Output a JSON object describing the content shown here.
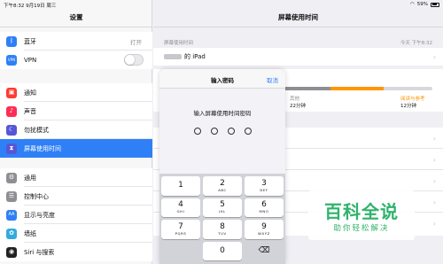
{
  "status_bar": {
    "time_date": "下午8:32  9月19日 周三",
    "battery": "59%"
  },
  "sidebar": {
    "title": "设置",
    "group1": [
      {
        "label": "蓝牙",
        "value": "打开",
        "icon": "bluetooth-icon",
        "icon_glyph": "ᛒ",
        "color": "#2f80f7"
      },
      {
        "label": "VPN",
        "icon": "vpn-icon",
        "icon_glyph": "VPN",
        "color": "#2f80f7"
      }
    ],
    "group2": [
      {
        "label": "通知",
        "icon": "notifications-icon",
        "icon_glyph": "▣",
        "color": "#ff3b30"
      },
      {
        "label": "声音",
        "icon": "sound-icon",
        "icon_glyph": "♪",
        "color": "#ff2d55"
      },
      {
        "label": "勿扰模式",
        "icon": "moon-icon",
        "icon_glyph": "☾",
        "color": "#5856d6"
      },
      {
        "label": "屏幕使用时间",
        "icon": "hourglass-icon",
        "icon_glyph": "⧗",
        "color": "#5856d6"
      }
    ],
    "group3": [
      {
        "label": "通用",
        "icon": "gear-icon",
        "icon_glyph": "⚙",
        "color": "#8e8e93"
      },
      {
        "label": "控制中心",
        "icon": "control-center-icon",
        "icon_glyph": "☰",
        "color": "#8e8e93"
      },
      {
        "label": "显示与亮度",
        "icon": "display-icon",
        "icon_glyph": "AA",
        "color": "#2f80f7"
      },
      {
        "label": "墙纸",
        "icon": "wallpaper-icon",
        "icon_glyph": "✿",
        "color": "#34aadc"
      },
      {
        "label": "Siri 与搜索",
        "icon": "siri-icon",
        "icon_glyph": "◉",
        "color": "#222222"
      }
    ]
  },
  "main": {
    "title": "屏幕使用时间",
    "section_header": "屏幕使用时间",
    "date": "今天 下午8:32",
    "device": "的 iPad",
    "usage": {
      "left_label": "其他",
      "left_value": "22分钟",
      "right_label": "阅读与参考",
      "right_value": "12分钟",
      "bar_fraction_other": 0.62,
      "bar_fraction_reading": 0.2
    }
  },
  "passcode": {
    "title": "输入密码",
    "cancel": "取消",
    "prompt": "输入屏幕使用时间密码",
    "digits_entered": 0,
    "digits_total": 4,
    "keys": [
      {
        "d": "1",
        "l": ""
      },
      {
        "d": "2",
        "l": "ABC"
      },
      {
        "d": "3",
        "l": "DEF"
      },
      {
        "d": "4",
        "l": "GHI"
      },
      {
        "d": "5",
        "l": "JKL"
      },
      {
        "d": "6",
        "l": "MNO"
      },
      {
        "d": "7",
        "l": "PQRS"
      },
      {
        "d": "8",
        "l": "TUV"
      },
      {
        "d": "9",
        "l": "WXYZ"
      }
    ],
    "zero": "0"
  },
  "watermark": {
    "big": "百科全说",
    "small": "助你轻松解决"
  },
  "colors": {
    "accent": "#2f80f7",
    "orange": "#ff9500",
    "watermark": "#2fb36b"
  }
}
